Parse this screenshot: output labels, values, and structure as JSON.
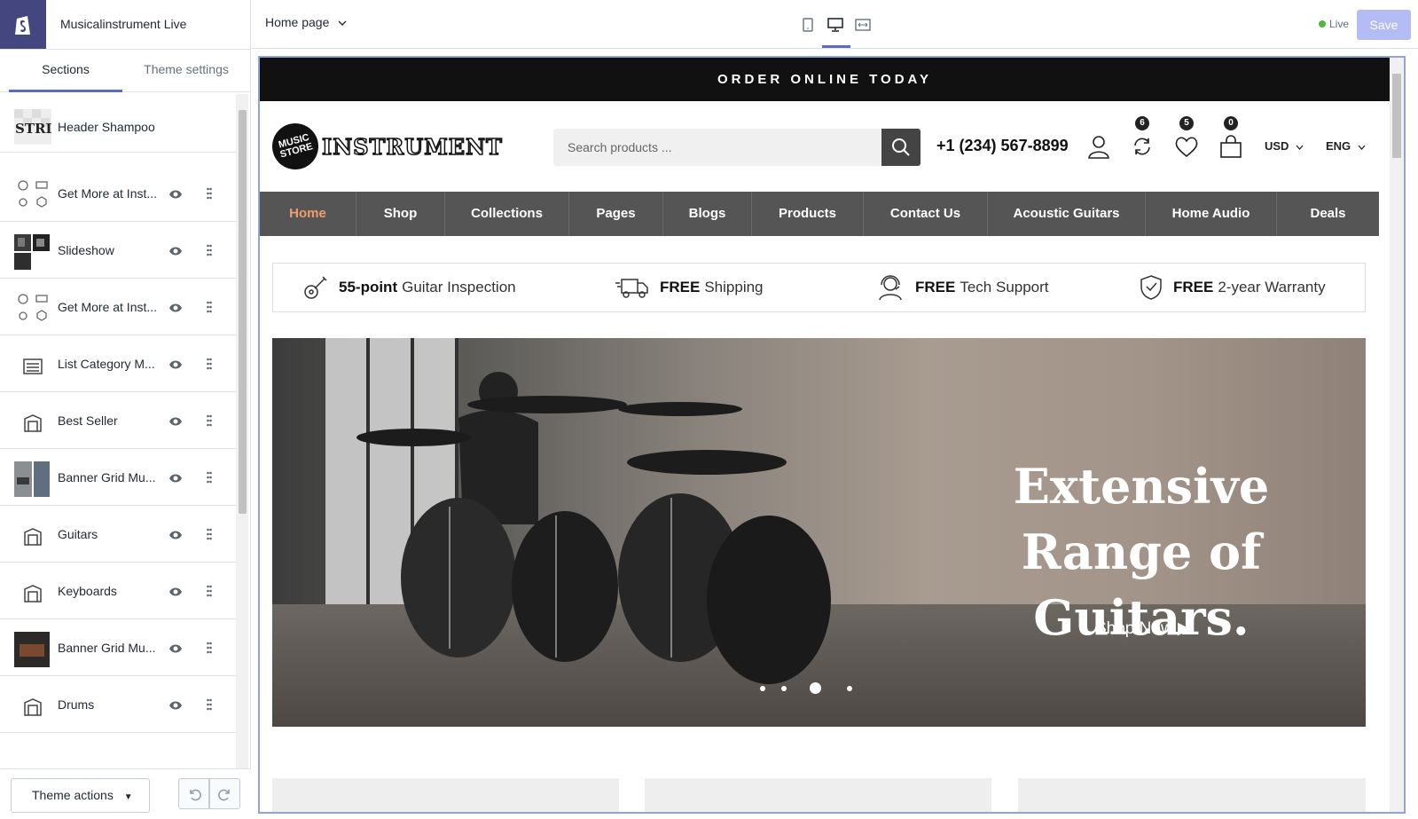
{
  "editor": {
    "store_name": "Musicalinstrument Live",
    "tabs": {
      "sections": "Sections",
      "theme_settings": "Theme settings"
    },
    "sections": [
      {
        "label": "Header Shampoo",
        "thumb": "header-thumbnail"
      },
      {
        "label": "Get More at Inst...",
        "thumb": "features-thumbnail"
      },
      {
        "label": "Slideshow",
        "thumb": "slideshow-thumbnail"
      },
      {
        "label": "Get More at Inst...",
        "thumb": "features-thumbnail"
      },
      {
        "label": "List Category M...",
        "thumb": "list-icon"
      },
      {
        "label": "Best Seller",
        "thumb": "product-tag-icon"
      },
      {
        "label": "Banner Grid Mu...",
        "thumb": "banner-thumbnail"
      },
      {
        "label": "Guitars",
        "thumb": "product-tag-icon"
      },
      {
        "label": "Keyboards",
        "thumb": "product-tag-icon"
      },
      {
        "label": "Banner Grid Mu...",
        "thumb": "banner-thumbnail"
      },
      {
        "label": "Drums",
        "thumb": "product-tag-icon"
      }
    ],
    "theme_actions": "Theme actions",
    "page_select": "Home page",
    "status": "Live",
    "save": "Save",
    "accent": "#5c6ac4"
  },
  "preview": {
    "announcement": "ORDER ONLINE TODAY",
    "logo_circle": "MUSIC STORE",
    "logo_word": "INSTRUMENT",
    "search_placeholder": "Search products ...",
    "phone": "+1 (234) 567-8899",
    "badges": {
      "compare": "6",
      "wishlist": "5",
      "cart": "0"
    },
    "currency": "USD",
    "language": "ENG",
    "nav": [
      "Home",
      "Shop",
      "Collections",
      "Pages",
      "Blogs",
      "Products",
      "Contact Us",
      "Acoustic Guitars",
      "Home Audio",
      "Deals"
    ],
    "features": [
      {
        "bold": "55-point",
        "text": "Guitar Inspection",
        "icon": "guitar-icon"
      },
      {
        "bold": "FREE",
        "text": "Shipping",
        "icon": "truck-icon"
      },
      {
        "bold": "FREE",
        "text": "Tech Support",
        "icon": "support-agent-icon"
      },
      {
        "bold": "FREE",
        "text": "2-year Warranty",
        "icon": "shield-icon"
      }
    ],
    "hero": {
      "line1": "Extensive",
      "line2": "Range of Guitars.",
      "cta": "Shop Now ▶",
      "slide_count": 4,
      "active_slide": 3
    },
    "nav_active_color": "#f39c6b"
  }
}
